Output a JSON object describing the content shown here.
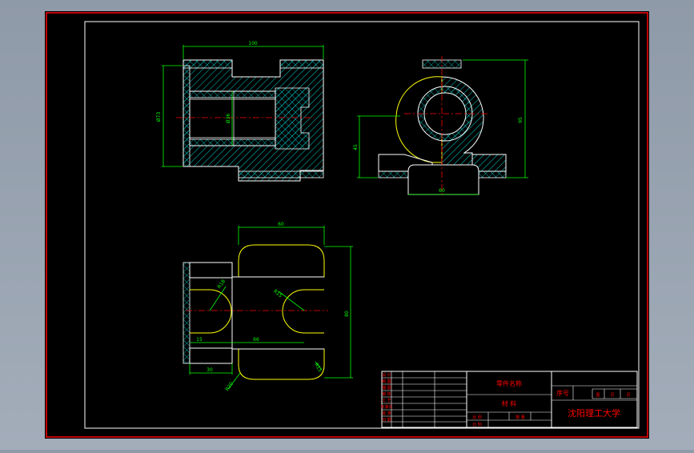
{
  "drawing": {
    "dims": {
      "front_width": "100",
      "front_height_left": "Ø73",
      "front_bore": "Ø36",
      "side_height": "95",
      "side_center": "45",
      "side_base": "60",
      "top_width": "60",
      "top_height": "80",
      "top_r1": "R18",
      "top_r2": "R15",
      "top_dist1": "15",
      "top_dist2": "66",
      "top_dist3": "30",
      "top_r3": "R20",
      "top_r4": "R15"
    }
  },
  "title_block": {
    "part_name": "零件名称",
    "material": "材  料",
    "seq": "序号",
    "school": "沈阳理工大学",
    "left_rows": [
      "设 计",
      "制 图",
      "描 图",
      "审 核",
      "工 艺",
      "标准化",
      "批 准",
      "日 期"
    ],
    "small_labels": [
      "比 例",
      "数 量",
      "重 量"
    ],
    "right_labels": [
      "图",
      "页",
      "页"
    ],
    "bottom_labels": [
      "数 量",
      "比 例"
    ]
  },
  "colors": {
    "background": "#000000",
    "frame": "#ff0000",
    "outline": "#ffffff",
    "dimension": "#00ff00",
    "hatch": "#00ffff",
    "edges": "#ffff00",
    "centerline": "#ff0000",
    "text_red": "#ff0000"
  }
}
